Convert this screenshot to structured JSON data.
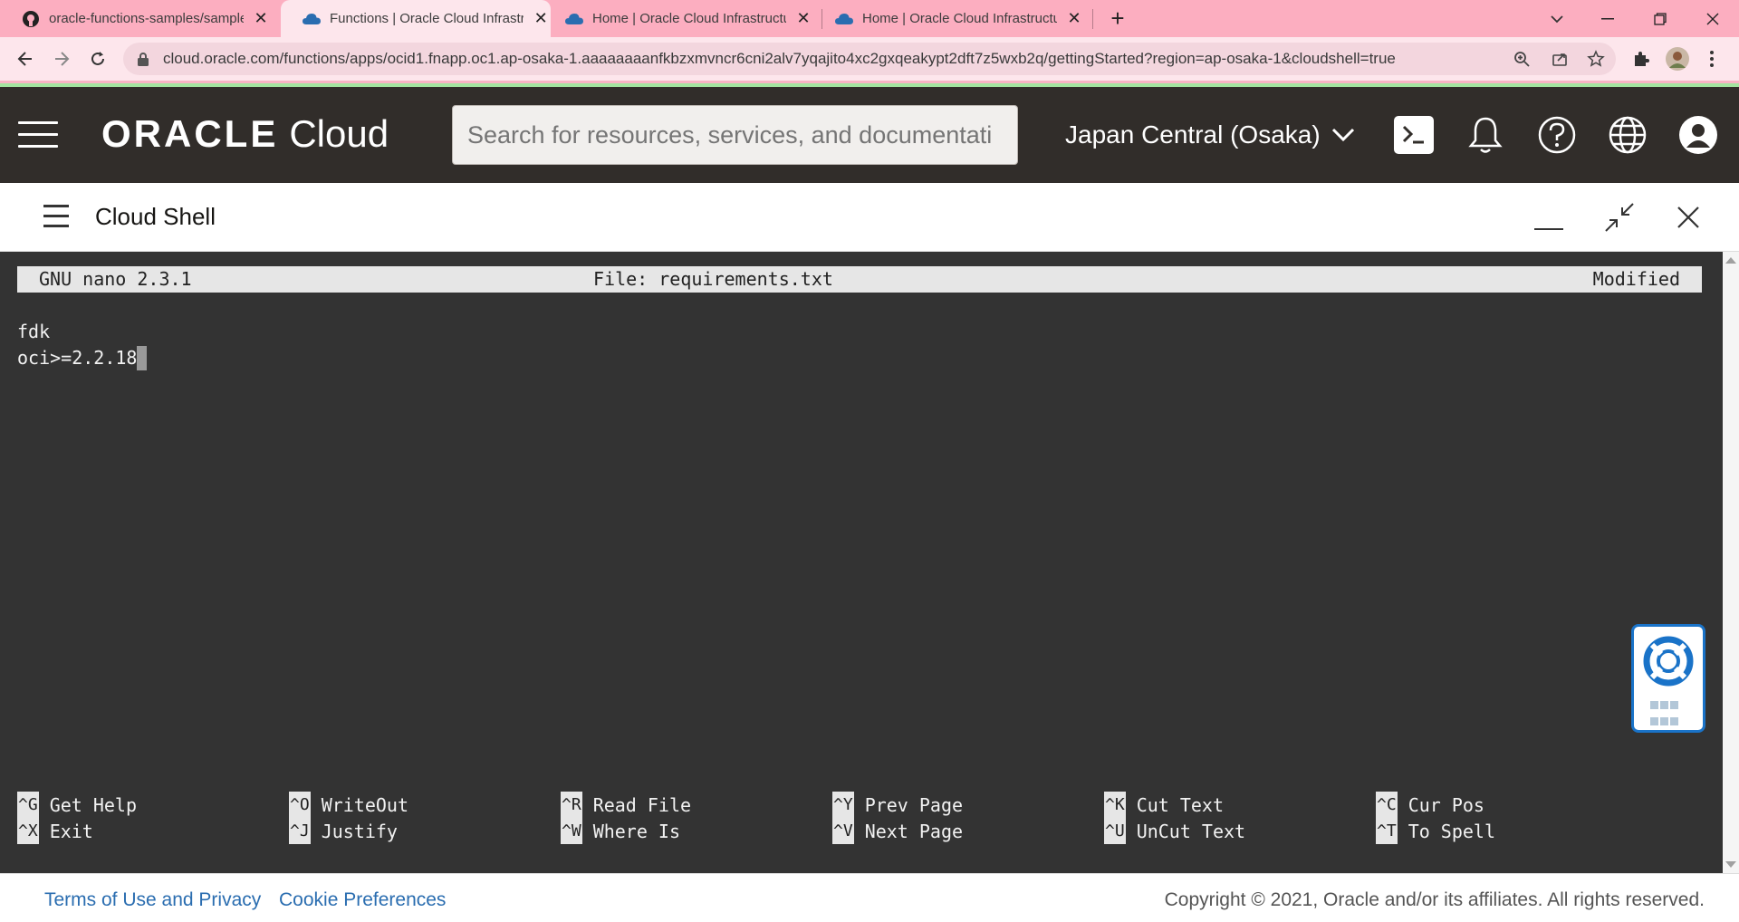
{
  "browser": {
    "tabs": [
      {
        "title": "oracle-functions-samples/sample",
        "icon": "github-icon",
        "active": false
      },
      {
        "title": "Functions | Oracle Cloud Infrastru",
        "icon": "cloud-icon",
        "active": true
      },
      {
        "title": "Home | Oracle Cloud Infrastructu",
        "icon": "cloud-icon",
        "active": false
      },
      {
        "title": "Home | Oracle Cloud Infrastructu",
        "icon": "cloud-icon",
        "active": false
      }
    ],
    "url": "cloud.oracle.com/functions/apps/ocid1.fnapp.oc1.ap-osaka-1.aaaaaaaanfkbzxmvncr6cni2alv7yqajito4xc2gxqeakypt2dft7z5wxb2q/gettingStarted?region=ap-osaka-1&cloudshell=true"
  },
  "header": {
    "brand": "ORACLE",
    "brand_suffix": "Cloud",
    "search_placeholder": "Search for resources, services, and documentati",
    "region": "Japan Central (Osaka)"
  },
  "cloudshell": {
    "title": "Cloud Shell"
  },
  "nano": {
    "version": "GNU nano 2.3.1",
    "file": "File: requirements.txt",
    "status": "Modified",
    "lines": [
      "fdk",
      "oci>=2.2.18"
    ],
    "shortcuts": [
      {
        "key": "^G",
        "label": "Get Help"
      },
      {
        "key": "^X",
        "label": "Exit"
      },
      {
        "key": "^O",
        "label": "WriteOut"
      },
      {
        "key": "^J",
        "label": "Justify"
      },
      {
        "key": "^R",
        "label": "Read File"
      },
      {
        "key": "^W",
        "label": "Where Is"
      },
      {
        "key": "^Y",
        "label": "Prev Page"
      },
      {
        "key": "^V",
        "label": "Next Page"
      },
      {
        "key": "^K",
        "label": "Cut Text"
      },
      {
        "key": "^U",
        "label": "UnCut Text"
      },
      {
        "key": "^C",
        "label": "Cur Pos"
      },
      {
        "key": "^T",
        "label": "To Spell"
      }
    ]
  },
  "footer": {
    "terms": "Terms of Use and Privacy",
    "cookies": "Cookie Preferences",
    "copyright": "Copyright © 2021, Oracle and/or its affiliates. All rights reserved."
  },
  "colors": {
    "tab_strip": "#fcaec0",
    "header_bg": "#312d2a",
    "terminal_bg": "#333333",
    "link": "#2a6db0",
    "help_accent": "#1a73c8"
  }
}
